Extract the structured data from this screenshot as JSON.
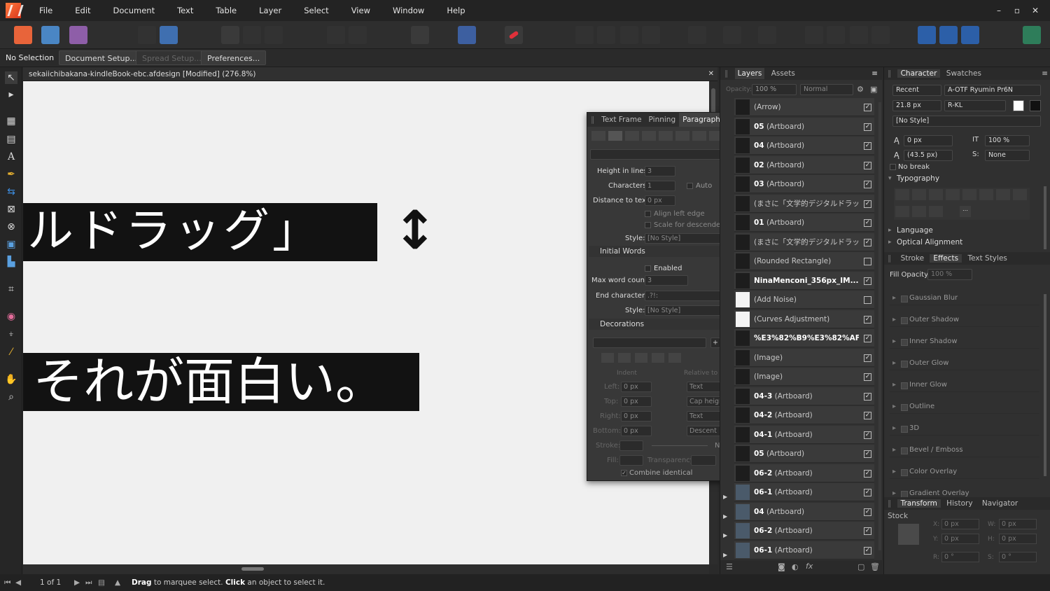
{
  "menubar": {
    "items": [
      "File",
      "Edit",
      "Document",
      "Text",
      "Table",
      "Layer",
      "Select",
      "View",
      "Window",
      "Help"
    ],
    "window_controls": [
      "–",
      "▫",
      "✕"
    ]
  },
  "context": {
    "selection": "No Selection",
    "document_setup": "Document Setup...",
    "spread_setup": "Spread Setup...",
    "preferences": "Preferences..."
  },
  "document": {
    "tab_title": "sekaiichibakana-kindleBook-ebc.afdesign [Modified] (276.8%)",
    "close": "✕",
    "text_line_1": "ルドラッグ」",
    "text_line_2": "それが面白い。",
    "arrow_glyph": "↕"
  },
  "paragraph_panel": {
    "tabs": [
      "Text Frame",
      "Pinning",
      "Paragraph"
    ],
    "active_tab": "Paragraph",
    "height_in_lines_label": "Height in lines:",
    "height_in_lines": "3",
    "characters_label": "Characters:",
    "characters": "1",
    "auto_label": "Auto",
    "distance_label": "Distance to text:",
    "distance": "0 px",
    "align_left_edge": "Align left edge",
    "scale_descenders": "Scale for descenders",
    "style_label": "Style:",
    "style_value": "[No Style]",
    "initial_words": "Initial Words",
    "enabled": "Enabled",
    "max_word_count_label": "Max word count:",
    "max_word_count": "3",
    "end_characters_label": "End characters:",
    "end_characters": ".?!:",
    "style2_label": "Style:",
    "style2_value": "[No Style]",
    "decorations": "Decorations",
    "indent_label": "Indent",
    "relative_label": "Relative to",
    "left_label": "Left:",
    "left_value": "0 px",
    "left_rel": "Text",
    "top_label": "Top:",
    "top_value": "0 px",
    "top_rel": "Cap height",
    "right_label": "Right:",
    "right_value": "0 px",
    "right_rel": "Text",
    "bottom_label": "Bottom:",
    "bottom_value": "0 px",
    "bottom_rel": "Descent",
    "stroke_label": "Stroke:",
    "stroke_none": "None",
    "fill_label": "Fill:",
    "transparency_label": "Transparency:",
    "combine_identical": "Combine identical"
  },
  "layers": {
    "tabs": [
      "Layers",
      "Assets"
    ],
    "opacity_label": "Opacity:",
    "opacity": "100 %",
    "blend": "Normal",
    "rows": [
      {
        "bold": "",
        "name": "(Arrow)"
      },
      {
        "bold": "05",
        "name": "(Artboard)"
      },
      {
        "bold": "04",
        "name": "(Artboard)"
      },
      {
        "bold": "02",
        "name": "(Artboard)"
      },
      {
        "bold": "03",
        "name": "(Artboard)"
      },
      {
        "bold": "",
        "name": "(まさに「文学的デジタルドラッグ」..."
      },
      {
        "bold": "01",
        "name": "(Artboard)"
      },
      {
        "bold": "",
        "name": "(まさに「文学的デジタルドラッ..."
      },
      {
        "bold": "",
        "name": "(Rounded Rectangle)"
      },
      {
        "bold": "NinaMenconi_356px_IM...",
        "name": ""
      },
      {
        "bold": "",
        "name": "(Add Noise)"
      },
      {
        "bold": "",
        "name": "(Curves Adjustment)"
      },
      {
        "bold": "%E3%82%B9%E3%82%AF...",
        "name": ""
      },
      {
        "bold": "",
        "name": "(Image)"
      },
      {
        "bold": "",
        "name": "(Image)"
      },
      {
        "bold": "04-3",
        "name": "(Artboard)"
      },
      {
        "bold": "04-2",
        "name": "(Artboard)"
      },
      {
        "bold": "04-1",
        "name": "(Artboard)"
      },
      {
        "bold": "05",
        "name": "(Artboard)"
      },
      {
        "bold": "06-2",
        "name": "(Artboard)"
      },
      {
        "bold": "06-1",
        "name": "(Artboard)"
      },
      {
        "bold": "04",
        "name": "(Artboard)"
      },
      {
        "bold": "06-2",
        "name": "(Artboard)"
      },
      {
        "bold": "06-1",
        "name": "(Artboard)"
      }
    ]
  },
  "character": {
    "tabs": [
      "Character",
      "Swatches"
    ],
    "recent": "Recent",
    "font": "A-OTF Ryumin Pr6N",
    "size": "21.8 px",
    "weight": "R-KL",
    "style": "[No Style]",
    "tracking": "0 px",
    "scale": "100 %",
    "leading": "(43.5 px)",
    "strike": "None",
    "strike_label": "S:",
    "scale_label": "IT",
    "no_break": "No break",
    "typography": "Typography",
    "language": "Language",
    "optical_alignment": "Optical Alignment"
  },
  "effects": {
    "tabs": [
      "Stroke",
      "Effects",
      "Text Styles"
    ],
    "fill_opacity_label": "Fill Opacity:",
    "fill_opacity": "100 %",
    "items": [
      "Gaussian Blur",
      "Outer Shadow",
      "Inner Shadow",
      "Outer Glow",
      "Inner Glow",
      "Outline",
      "3D",
      "Bevel / Emboss",
      "Color Overlay",
      "Gradient Overlay"
    ]
  },
  "transform": {
    "tabs": [
      "Transform",
      "History",
      "Navigator",
      "Stock"
    ],
    "x": "0 px",
    "y": "0 px",
    "w": "0 px",
    "h": "0 px",
    "r": "0 °",
    "s": "0 °",
    "x_label": "X:",
    "y_label": "Y:",
    "w_label": "W:",
    "h_label": "H:",
    "r_label": "R:",
    "s_label": "S:"
  },
  "status": {
    "page": "1 of 1",
    "hint_drag": "Drag",
    "hint_1": " to marquee select. ",
    "hint_click": "Click",
    "hint_2": " an object to select it."
  },
  "colors": {
    "accent": "#e8643a",
    "panel": "#383838",
    "canvas": "#f0f0f0",
    "text_block": "#121212"
  }
}
